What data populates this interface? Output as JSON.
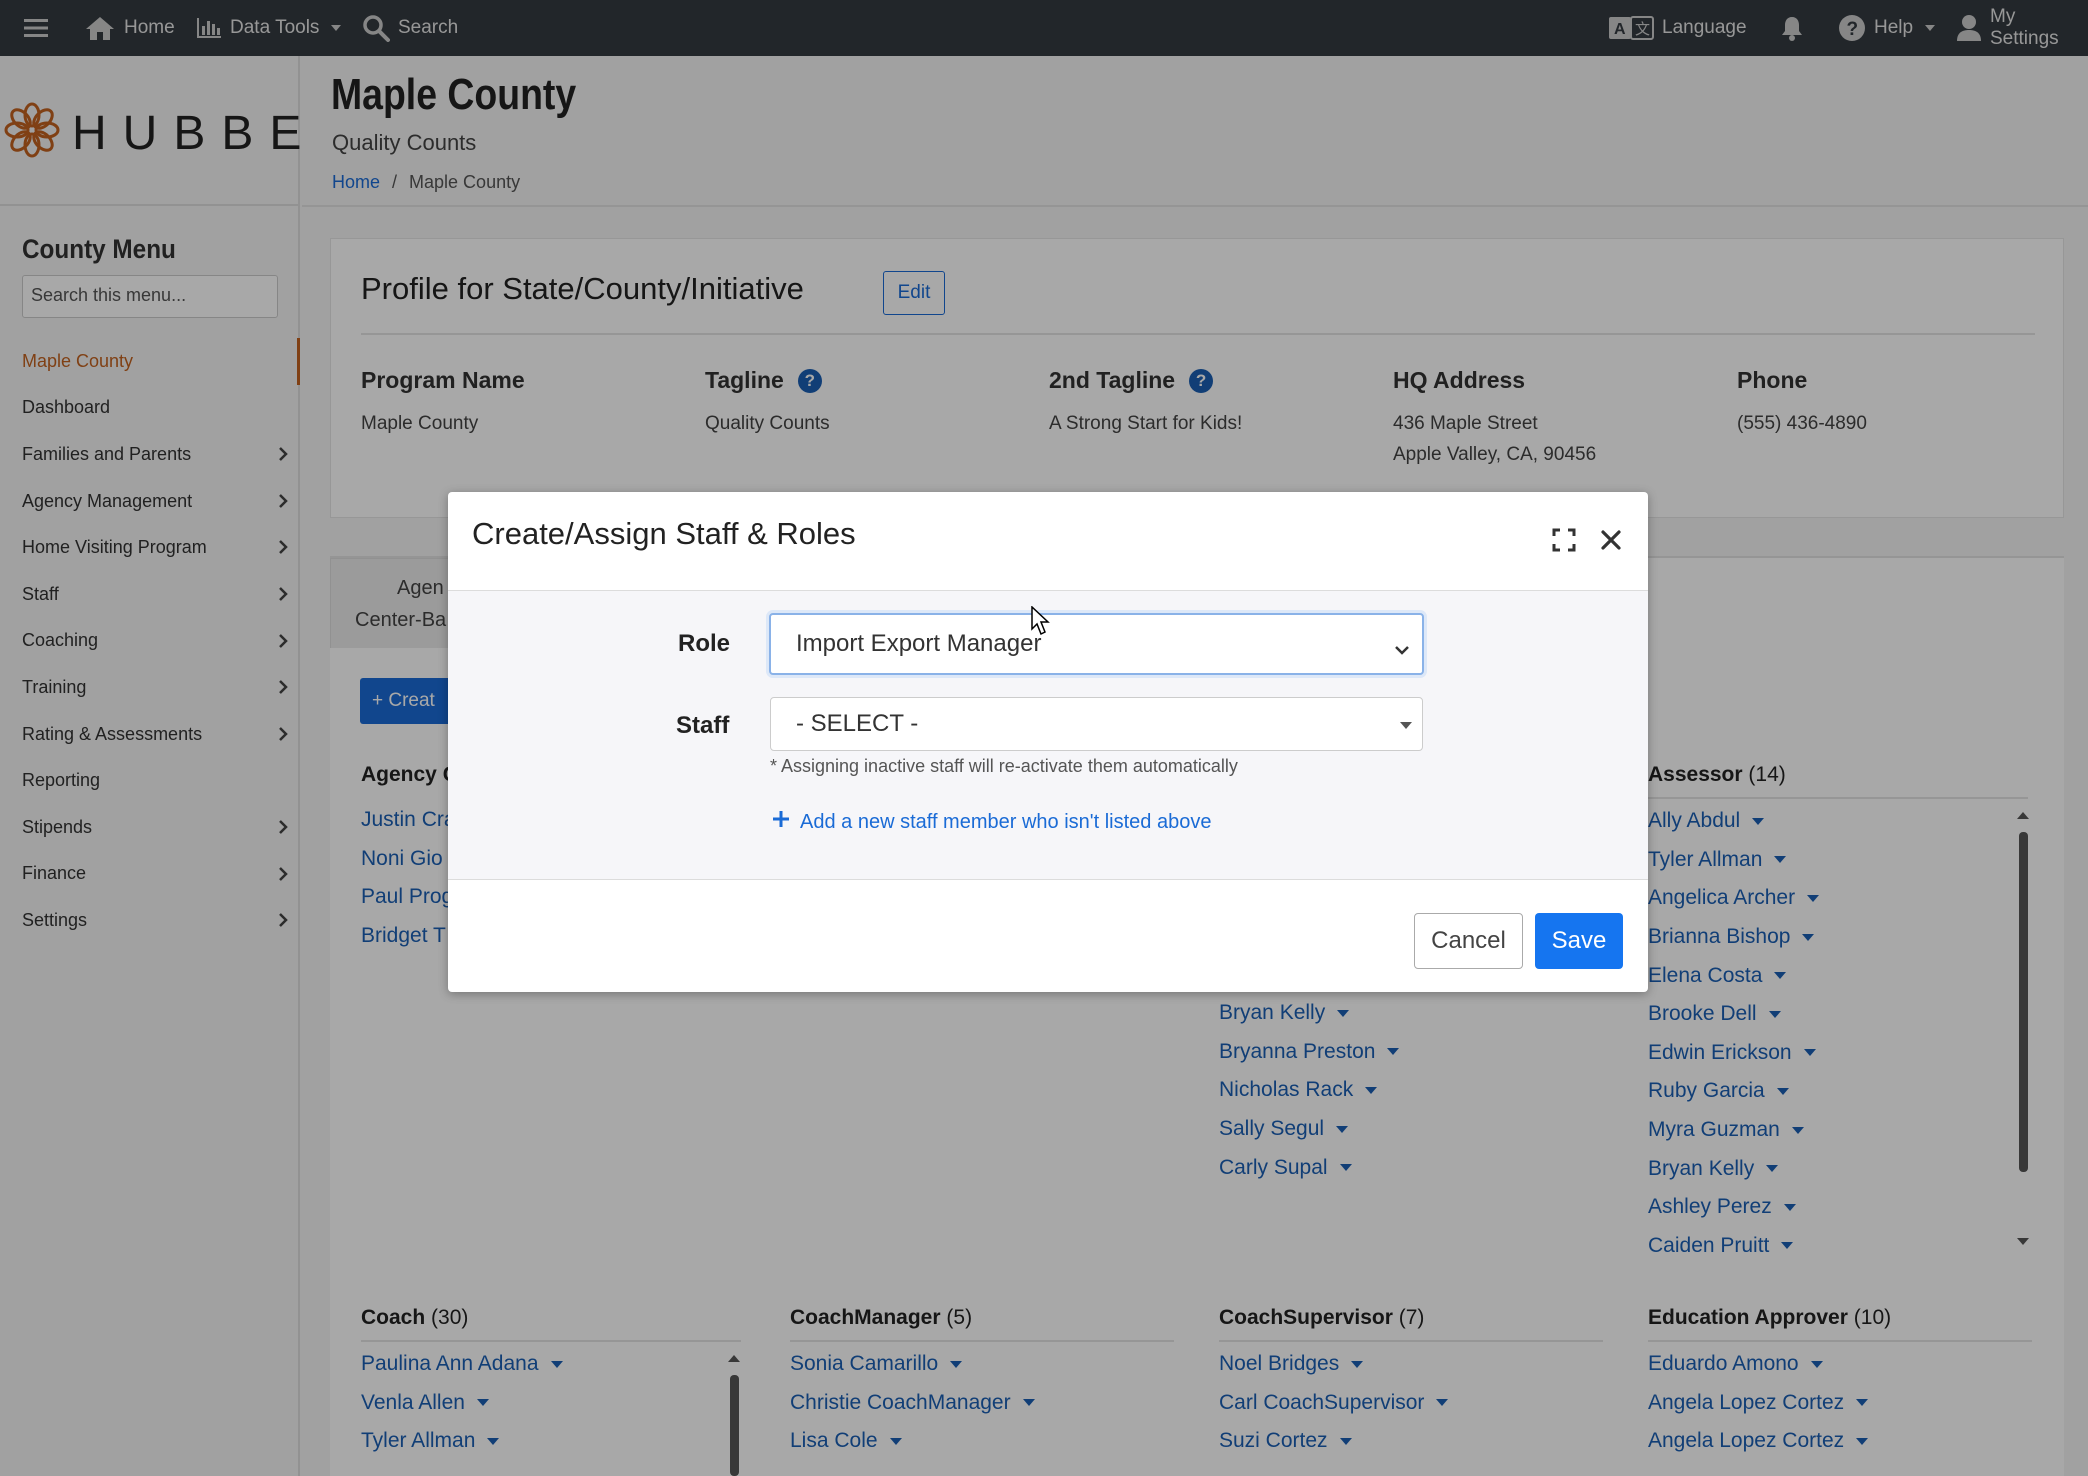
{
  "topnav": {
    "home": "Home",
    "data_tools": "Data Tools",
    "search": "Search",
    "language": "Language",
    "help": "Help",
    "settings": "My Settings"
  },
  "brand": {
    "wordmark": "HUBBE"
  },
  "sidebar": {
    "title": "County Menu",
    "search_placeholder": "Search this menu...",
    "items": [
      {
        "label": "Maple County",
        "active": true,
        "submenu": false
      },
      {
        "label": "Dashboard",
        "submenu": false
      },
      {
        "label": "Families and Parents",
        "submenu": true
      },
      {
        "label": "Agency Management",
        "submenu": true
      },
      {
        "label": "Home Visiting Program",
        "submenu": true
      },
      {
        "label": "Staff",
        "submenu": true
      },
      {
        "label": "Coaching",
        "submenu": true
      },
      {
        "label": "Training",
        "submenu": true
      },
      {
        "label": "Rating & Assessments",
        "submenu": true
      },
      {
        "label": "Reporting",
        "submenu": false
      },
      {
        "label": "Stipends",
        "submenu": true
      },
      {
        "label": "Finance",
        "submenu": true
      },
      {
        "label": "Settings",
        "submenu": true
      }
    ]
  },
  "header": {
    "title": "Maple County",
    "subtitle": "Quality Counts",
    "breadcrumb": {
      "home": "Home",
      "sep": "/",
      "current": "Maple County"
    }
  },
  "profile": {
    "title": "Profile for State/County/Initiative",
    "edit": "Edit",
    "program_name_label": "Program Name",
    "program_name": "Maple County",
    "tagline_label": "Tagline",
    "tagline": "Quality Counts",
    "tagline2_label": "2nd Tagline",
    "tagline2": "A Strong Start for Kids!",
    "hq_label": "HQ Address",
    "hq_line1": "436 Maple Street",
    "hq_line2": "Apple Valley, CA, 90456",
    "phone_label": "Phone",
    "phone": "(555) 436-4890",
    "help_glyph": "?"
  },
  "tabs": {
    "line1": "Agen",
    "line2": "Center-Ba"
  },
  "create_button": "+ Creat",
  "roles": {
    "agency": {
      "title": "Agency C",
      "people": [
        "Justin Cra",
        "Noni Gio",
        "Paul Prog",
        "Bridget T"
      ]
    },
    "middle": {
      "people": [
        "Bryan Kelly",
        "Bryanna Preston",
        "Nicholas Rack",
        "Sally Segul",
        "Carly Supal"
      ]
    },
    "assessor": {
      "title": "Assessor",
      "count": "(14)",
      "people": [
        "Ally Abdul",
        "Tyler Allman",
        "Angelica Archer",
        "Brianna Bishop",
        "Elena Costa",
        "Brooke Dell",
        "Edwin Erickson",
        "Ruby Garcia",
        "Myra Guzman",
        "Bryan Kelly",
        "Ashley Perez",
        "Caiden Pruitt"
      ]
    },
    "coach": {
      "title": "Coach",
      "count": "(30)",
      "people": [
        "Paulina Ann Adana",
        "Venla Allen",
        "Tyler Allman"
      ]
    },
    "coach_manager": {
      "title": "CoachManager",
      "count": "(5)",
      "people": [
        "Sonia Camarillo",
        "Christie CoachManager",
        "Lisa Cole"
      ]
    },
    "coach_supervisor": {
      "title": "CoachSupervisor",
      "count": "(7)",
      "people": [
        "Noel Bridges",
        "Carl CoachSupervisor",
        "Suzi Cortez"
      ]
    },
    "education_approver": {
      "title": "Education Approver",
      "count": "(10)",
      "people": [
        "Eduardo Amono",
        "Angela Lopez Cortez",
        "Angela Lopez Cortez"
      ]
    }
  },
  "modal": {
    "title": "Create/Assign Staff & Roles",
    "role_label": "Role",
    "role_value": "Import Export Manager",
    "staff_label": "Staff",
    "staff_value": "- SELECT -",
    "hint": "* Assigning inactive staff will re-activate them automatically",
    "add_link": "Add a new staff member who isn't listed above",
    "cancel": "Cancel",
    "save": "Save"
  },
  "colors": {
    "accent": "#1a6bd6",
    "active_menu": "#c2621f",
    "topbar": "#343a40"
  }
}
